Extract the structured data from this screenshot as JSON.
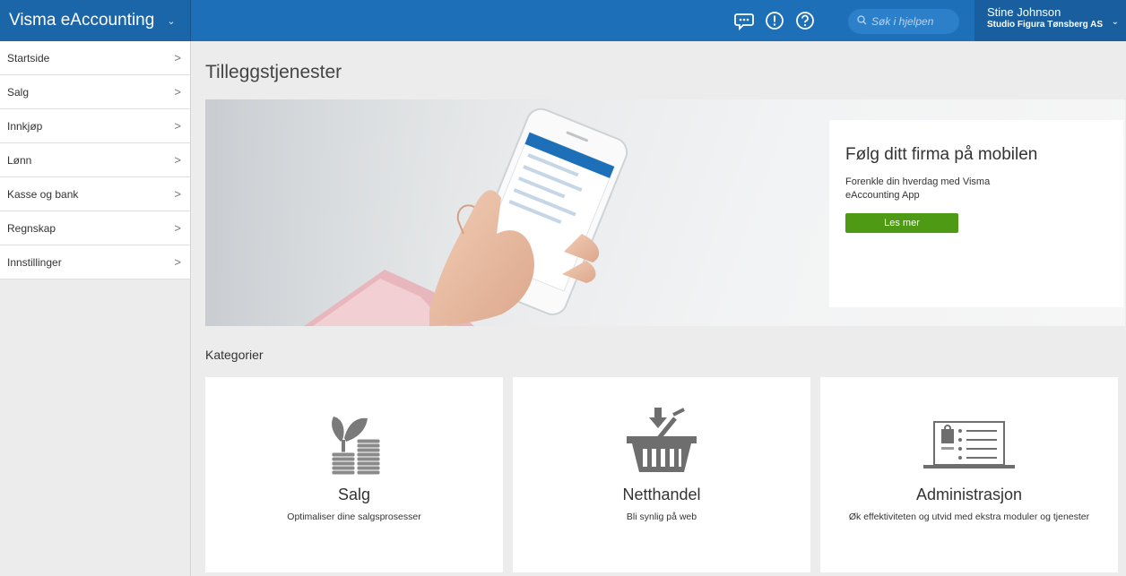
{
  "app": {
    "name": "Visma eAccounting"
  },
  "topbar": {
    "search_placeholder": "Søk i hjelpen",
    "user_name": "Stine Johnson",
    "company": "Studio Figura Tønsberg AS",
    "icons": [
      "chat-icon",
      "alert-icon",
      "help-icon",
      "search-icon"
    ]
  },
  "sidebar": {
    "items": [
      {
        "label": "Startside"
      },
      {
        "label": "Salg"
      },
      {
        "label": "Innkjøp"
      },
      {
        "label": "Lønn"
      },
      {
        "label": "Kasse og bank"
      },
      {
        "label": "Regnskap"
      },
      {
        "label": "Innstillinger"
      }
    ]
  },
  "main": {
    "title": "Tilleggstjenester",
    "promo": {
      "heading": "Følg ditt firma på mobilen",
      "text": "Forenkle din hverdag med Visma eAccounting App",
      "button": "Les mer"
    },
    "categories_title": "Kategorier",
    "categories": [
      {
        "title": "Salg",
        "desc": "Optimaliser dine salgsprosesser",
        "icon": "plant-coins-icon"
      },
      {
        "title": "Netthandel",
        "desc": "Bli synlig på web",
        "icon": "shopping-basket-icon"
      },
      {
        "title": "Administrasjon",
        "desc": "Øk effektiviteten og utvid med ekstra moduler og tjenester",
        "icon": "laptop-profile-icon"
      }
    ]
  },
  "colors": {
    "topbar": "#1d6fb8",
    "accent_green": "#4f9a14",
    "background": "#ececec"
  }
}
